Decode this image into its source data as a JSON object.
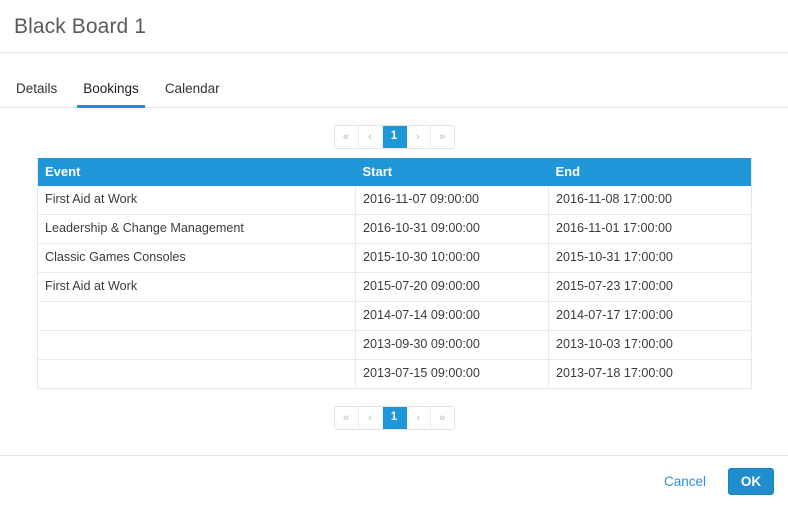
{
  "header": {
    "title": "Black Board 1"
  },
  "tabs": [
    {
      "label": "Details",
      "active": false
    },
    {
      "label": "Bookings",
      "active": true
    },
    {
      "label": "Calendar",
      "active": false
    }
  ],
  "pagination": {
    "first_label": "«",
    "prev_label": "‹",
    "current_label": "1",
    "next_label": "›",
    "last_label": "»"
  },
  "table": {
    "columns": [
      "Event",
      "Start",
      "End"
    ],
    "rows": [
      [
        "First Aid at Work",
        "2016-11-07 09:00:00",
        "2016-11-08 17:00:00"
      ],
      [
        "Leadership & Change Management",
        "2016-10-31 09:00:00",
        "2016-11-01 17:00:00"
      ],
      [
        "Classic Games Consoles",
        "2015-10-30 10:00:00",
        "2015-10-31 17:00:00"
      ],
      [
        "First Aid at Work",
        "2015-07-20 09:00:00",
        "2015-07-23 17:00:00"
      ],
      [
        "",
        "2014-07-14 09:00:00",
        "2014-07-17 17:00:00"
      ],
      [
        "",
        "2013-09-30 09:00:00",
        "2013-10-03 17:00:00"
      ],
      [
        "",
        "2013-07-15 09:00:00",
        "2013-07-18 17:00:00"
      ]
    ]
  },
  "footer": {
    "cancel_label": "Cancel",
    "ok_label": "OK"
  },
  "colors": {
    "accent": "#1e96d8",
    "ok_button": "#1f8ecd",
    "link": "#2f8fd8",
    "divider": "#e6e6e6",
    "title_text": "#5a5a5a"
  }
}
